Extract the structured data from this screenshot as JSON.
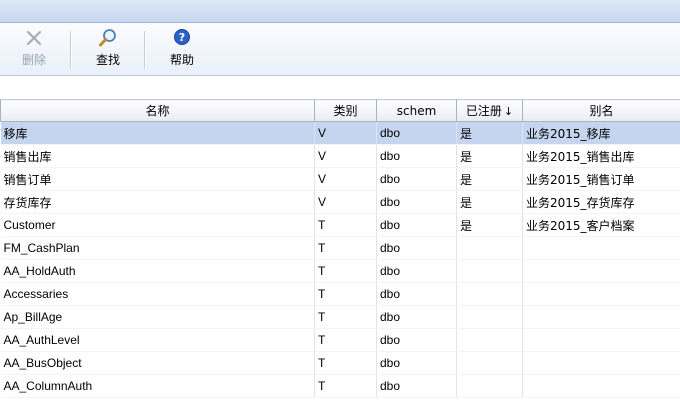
{
  "toolbar": {
    "delete_label": "删除",
    "find_label": "查找",
    "help_label": "帮助"
  },
  "table": {
    "columns": [
      "名称",
      "类别",
      "schem",
      "已注册",
      "别名"
    ],
    "sort_indicator": "↓",
    "rows": [
      {
        "name": "移库",
        "type": "V",
        "schema": "dbo",
        "registered": "是",
        "alias": "业务2015_移库"
      },
      {
        "name": "销售出库",
        "type": "V",
        "schema": "dbo",
        "registered": "是",
        "alias": "业务2015_销售出库"
      },
      {
        "name": "销售订单",
        "type": "V",
        "schema": "dbo",
        "registered": "是",
        "alias": "业务2015_销售订单"
      },
      {
        "name": "存货库存",
        "type": "V",
        "schema": "dbo",
        "registered": "是",
        "alias": "业务2015_存货库存"
      },
      {
        "name": "Customer",
        "type": "T",
        "schema": "dbo",
        "registered": "是",
        "alias": "业务2015_客户档案"
      },
      {
        "name": "FM_CashPlan",
        "type": "T",
        "schema": "dbo",
        "registered": "",
        "alias": ""
      },
      {
        "name": "AA_HoldAuth",
        "type": "T",
        "schema": "dbo",
        "registered": "",
        "alias": ""
      },
      {
        "name": "Accessaries",
        "type": "T",
        "schema": "dbo",
        "registered": "",
        "alias": ""
      },
      {
        "name": "Ap_BillAge",
        "type": "T",
        "schema": "dbo",
        "registered": "",
        "alias": ""
      },
      {
        "name": "AA_AuthLevel",
        "type": "T",
        "schema": "dbo",
        "registered": "",
        "alias": ""
      },
      {
        "name": "AA_BusObject",
        "type": "T",
        "schema": "dbo",
        "registered": "",
        "alias": ""
      },
      {
        "name": "AA_ColumnAuth",
        "type": "T",
        "schema": "dbo",
        "registered": "",
        "alias": ""
      }
    ]
  }
}
